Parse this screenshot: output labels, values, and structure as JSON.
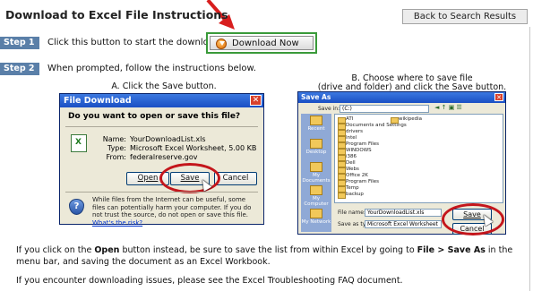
{
  "header": {
    "title": "Download to Excel File Instructions",
    "back_button": "Back to Search Results"
  },
  "step1": {
    "badge": "Step 1",
    "text": "Click this button to start the download:",
    "download_button": "Download Now"
  },
  "step2": {
    "badge": "Step 2",
    "text": "When prompted, follow the instructions below."
  },
  "captions": {
    "a": "A. Click the Save button.",
    "b_line1": "B. Choose where to save file",
    "b_line2": "(drive and folder) and click the Save button."
  },
  "file_download_dialog": {
    "title": "File Download",
    "question": "Do you want to open or save this file?",
    "name_label": "Name:",
    "name_value": "YourDownloadList.xls",
    "type_label": "Type:",
    "type_value": "Microsoft Excel Worksheet, 5.00 KB",
    "from_label": "From:",
    "from_value": "federalreserve.gov",
    "open_button": "Open",
    "save_button": "Save",
    "cancel_button": "Cancel",
    "warning": "While files from the Internet can be useful, some files can potentially harm your computer. If you do not trust the source, do not open or save this file.",
    "warning_link": "What's the risk?"
  },
  "save_as_dialog": {
    "title": "Save As",
    "save_in_label": "Save in:",
    "save_in_value": "(C:)",
    "places": [
      "Recent",
      "Desktop",
      "My Documents",
      "My Computer",
      "My Network"
    ],
    "folders_left": [
      "ATI",
      "Documents and Settings",
      "drivers",
      "Intel",
      "Program Files",
      "WINDOWS",
      "i386",
      "Dell",
      "Webs",
      "Office 2K",
      "Program Files",
      "Temp",
      "backup"
    ],
    "folders_right": [
      "wikipedia"
    ],
    "file_name_label": "File name:",
    "file_name_value": "YourDownloadList.xls",
    "save_type_label": "Save as type:",
    "save_type_value": "Microsoft Excel Worksheet",
    "save_button": "Save",
    "cancel_button": "Cancel"
  },
  "notes": {
    "p1_a": "If you click on the ",
    "p1_open": "Open",
    "p1_b": " button instead, be sure to save the list from within Excel by going to ",
    "p1_menu": "File > Save As",
    "p1_c": " in the menu bar, and saving the document as an Excel Workbook.",
    "p2": "If you encounter downloading issues, please see the Excel Troubleshooting FAQ document."
  },
  "colors": {
    "step_badge": "#5a7fa8",
    "download_frame": "#3a9a3a",
    "highlight_oval": "#c4161c",
    "arrow": "#d81e1e"
  }
}
